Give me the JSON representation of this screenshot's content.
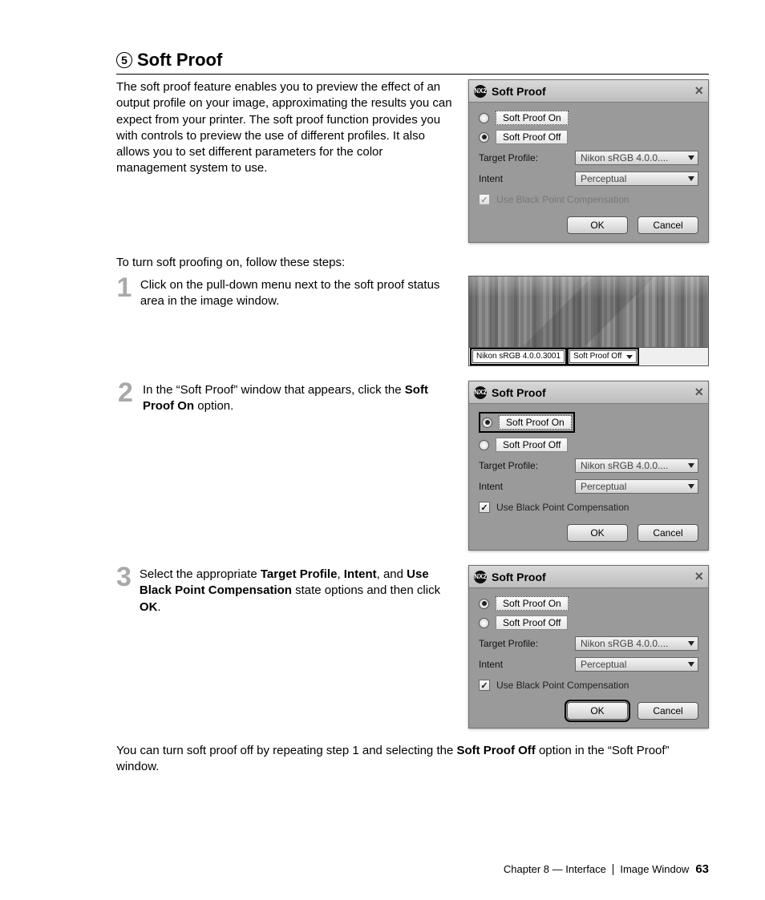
{
  "heading": {
    "num": "5",
    "title": "Soft Proof"
  },
  "intro": "The soft proof feature enables you to preview the effect of an output profile on your image, approximating the results you can expect from your printer. The soft proof function provides you with controls to preview the use of different profiles. It also allows you to set different parameters for the color management system to use.",
  "steps_lead": "To turn soft proofing on, follow these steps:",
  "steps": {
    "s1": {
      "num": "1",
      "text": "Click on the pull-down menu next to the soft proof status area in the image window."
    },
    "s2": {
      "num": "2",
      "text_a": "In the “Soft Proof” window that appears, click the ",
      "bold": "Soft Proof On",
      "text_b": " option."
    },
    "s3": {
      "num": "3",
      "pre": "Select the appropriate ",
      "b1": "Target Profile",
      "mid1": ", ",
      "b2": "Intent",
      "mid2": ", and ",
      "b3": "Use Black Point Compensation",
      "post1": " state options and then click ",
      "b4": "OK",
      "post2": "."
    }
  },
  "closing": {
    "a": "You can turn soft proof off by repeating step 1 and selecting the ",
    "b": "Soft Proof Off",
    "c": " option in the “Soft Proof” window."
  },
  "dialog": {
    "logo": "NX2",
    "title": "Soft Proof",
    "on": "Soft Proof On",
    "off": "Soft Proof Off",
    "target_lbl": "Target Profile:",
    "target_val": "Nikon sRGB 4.0.0....",
    "intent_lbl": "Intent",
    "intent_val": "Perceptual",
    "bpc": "Use Black Point Compensation",
    "ok": "OK",
    "cancel": "Cancel"
  },
  "imgwin": {
    "profile": "Nikon sRGB 4.0.0.3001",
    "status": "Soft Proof Off"
  },
  "footer": {
    "chapter": "Chapter 8 — Interface",
    "section": "Image Window",
    "page": "63"
  }
}
